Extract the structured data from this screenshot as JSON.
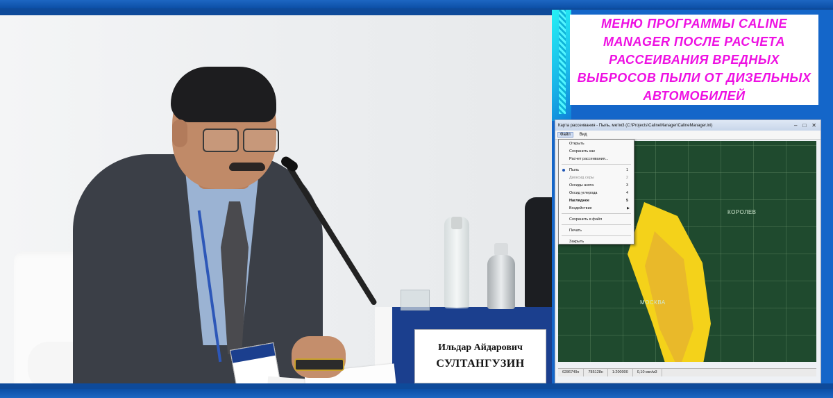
{
  "nameplate": {
    "line1": "Ильдар Айдарович",
    "line2": "СУЛТАНГУЗИН"
  },
  "slide": {
    "heading": "МЕНЮ ПРОГРАММЫ CALINE MANAGER ПОСЛЕ РАСЧЕТА РАССЕИВАНИЯ ВРЕДНЫХ ВЫБРОСОВ ПЫЛИ ОТ ДИЗЕЛЬНЫХ АВТОМОБИЛЕЙ",
    "heading_color": "#ee10e2",
    "window_title": "Карта рассеивания - Пыль, мкг/м3 (C:\\Projects\\CalineManager\\CalineManager.ini)",
    "window_controls": [
      "–",
      "□",
      "✕"
    ],
    "menubar": [
      "Файл",
      "Вид"
    ],
    "menu_items": [
      {
        "label": "Открыть",
        "shortcut": ""
      },
      {
        "label": "Сохранить как",
        "shortcut": ""
      },
      {
        "label": "Расчет рассеивания...",
        "shortcut": ""
      },
      {
        "label": "Пыль",
        "shortcut": "1"
      },
      {
        "label": "Диоксид серы",
        "shortcut": "2"
      },
      {
        "label": "Оксиды азота",
        "shortcut": "3"
      },
      {
        "label": "Оксид углерода",
        "shortcut": "4"
      },
      {
        "label": "Наглядное",
        "shortcut": "5"
      },
      {
        "label": "Воздействие",
        "shortcut": ""
      },
      {
        "label": "Сохранить в файл",
        "shortcut": ""
      },
      {
        "label": "Печать",
        "shortcut": ""
      },
      {
        "label": "Закрыть",
        "shortcut": ""
      }
    ],
    "map_labels": {
      "city": "МОСКВА",
      "north": "КОРОЛЕВ"
    },
    "plume_color": "#f4d21a",
    "status": [
      "6286749н",
      "785128н",
      "1:200000",
      "0,10 мкг/м3"
    ]
  },
  "colors": {
    "frame": "#0e4a9a",
    "podium": "#1b3f8e"
  }
}
